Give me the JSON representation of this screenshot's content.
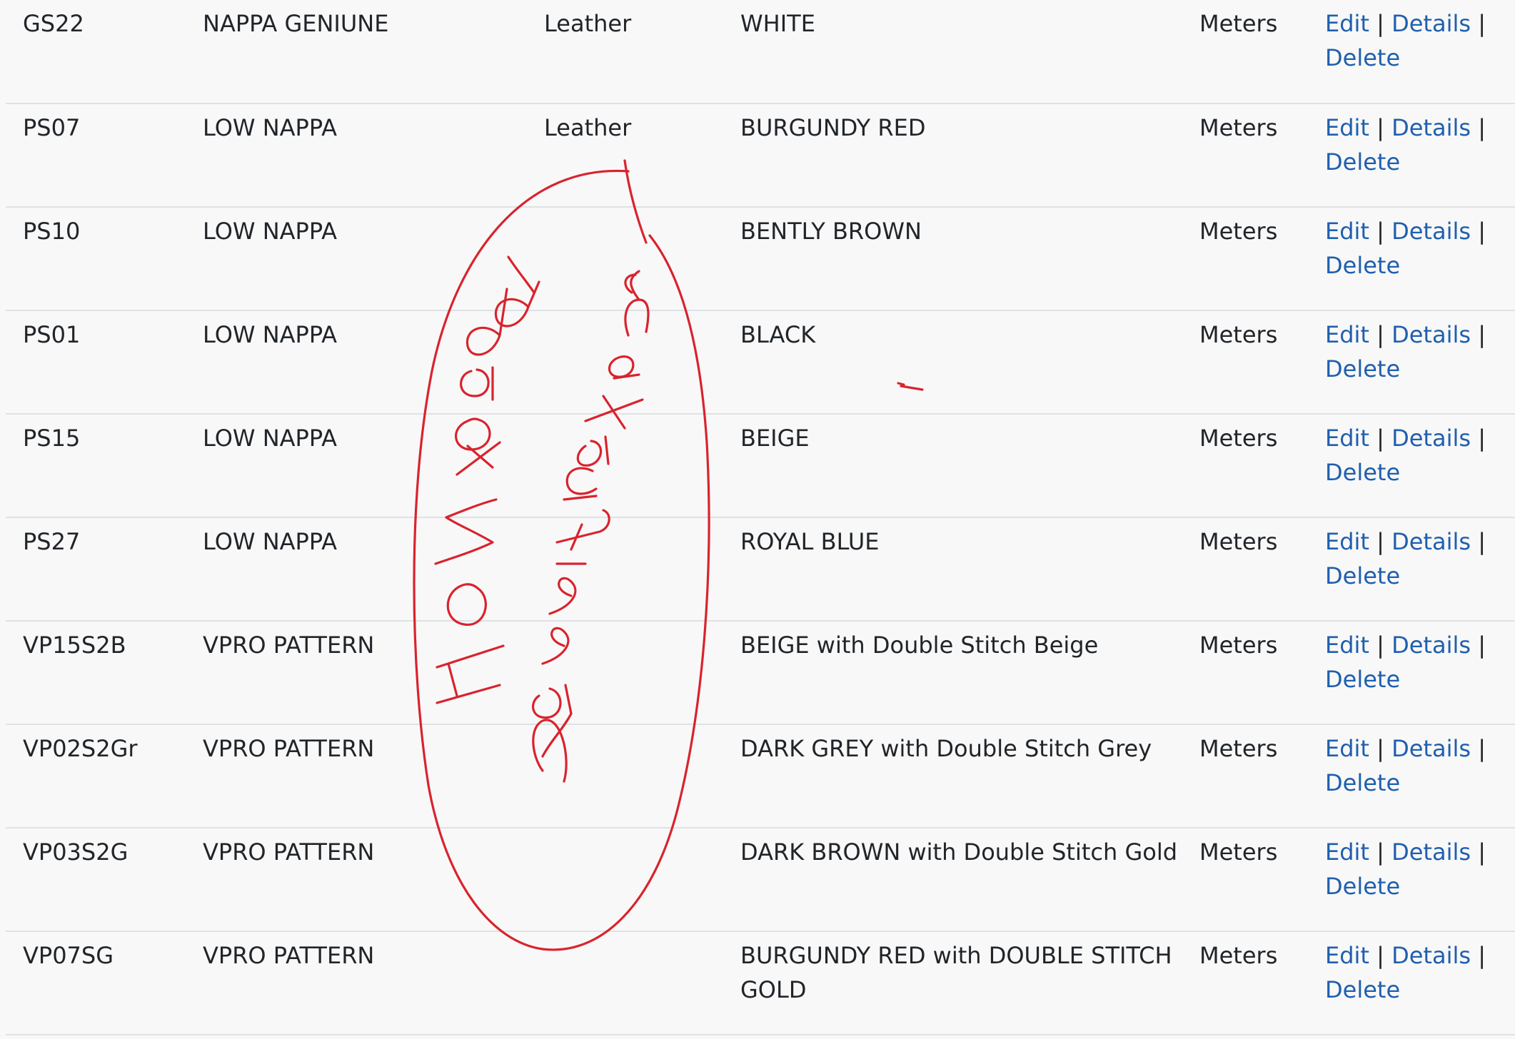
{
  "table": {
    "rows": [
      {
        "code": "GS22",
        "name": "NAPPA GENIUNE",
        "type": "Leather",
        "color": "WHITE",
        "unit": "Meters"
      },
      {
        "code": "PS07",
        "name": "LOW NAPPA",
        "type": "Leather",
        "color": "BURGUNDY RED",
        "unit": "Meters"
      },
      {
        "code": "PS10",
        "name": "LOW NAPPA",
        "type": "",
        "color": "BENTLY BROWN",
        "unit": "Meters"
      },
      {
        "code": "PS01",
        "name": "LOW NAPPA",
        "type": "",
        "color": "BLACK",
        "unit": "Meters"
      },
      {
        "code": "PS15",
        "name": "LOW NAPPA",
        "type": "",
        "color": "BEIGE",
        "unit": "Meters"
      },
      {
        "code": "PS27",
        "name": "LOW NAPPA",
        "type": "",
        "color": "ROYAL BLUE",
        "unit": "Meters"
      },
      {
        "code": "VP15S2B",
        "name": "VPRO PATTERN",
        "type": "",
        "color": "BEIGE with Double Stitch Beige",
        "unit": "Meters"
      },
      {
        "code": "VP02S2Gr",
        "name": "VPRO PATTERN",
        "type": "",
        "color": "DARK GREY with Double Stitch Grey",
        "unit": "Meters"
      },
      {
        "code": "VP03S2G",
        "name": "VPRO PATTERN",
        "type": "",
        "color": "DARK BROWN with Double Stitch Gold",
        "unit": "Meters"
      },
      {
        "code": "VP07SG",
        "name": "VPRO PATTERN",
        "type": "",
        "color": "BURGUNDY RED with DOUBLE STITCH GOLD",
        "unit": "Meters"
      }
    ],
    "actions": {
      "edit_label": "Edit",
      "details_label": "Details",
      "delete_label": "Delete",
      "separator": "|"
    }
  },
  "annotation": {
    "handwritten_text": "How to add classification",
    "color": "#d9232d"
  }
}
